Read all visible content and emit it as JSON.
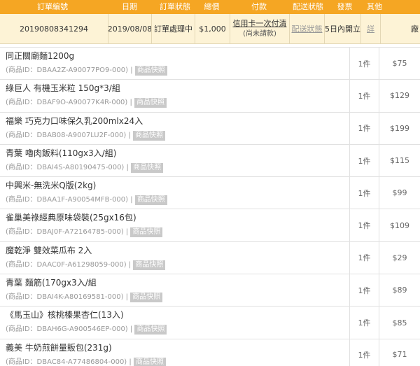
{
  "header": {
    "order_no": "訂單編號",
    "date": "日期",
    "status": "訂單狀態",
    "total": "總價",
    "payment": "付款",
    "shipping": "配送狀態",
    "invoice": "發票",
    "other": "其他"
  },
  "order": {
    "number": "20190808341294",
    "date": "2019/08/08",
    "status": "訂單處理中",
    "total": "$1,000",
    "payment_method": "信用卡一次付清",
    "payment_status": "(尚未請款)",
    "shipping_status": "配送狀態",
    "invoice": "5日內開立",
    "detail_link": "詳",
    "extra": "廠"
  },
  "items": [
    {
      "name": "同正關廟麵1200g",
      "code": "(商品ID：DBAA2Z-A90077PO9-000) |",
      "snapshot": "商品快照",
      "qty": "1件",
      "price": "$75"
    },
    {
      "name": "綠巨人 有機玉米粒 150g*3/組",
      "code": "(商品ID：DBAF9O-A90077K4R-000) |",
      "snapshot": "商品快照",
      "qty": "1件",
      "price": "$129"
    },
    {
      "name": "福樂 巧克力口味保久乳200mlx24入",
      "code": "(商品ID：DBAB08-A9007LU2F-000) |",
      "snapshot": "商品快照",
      "qty": "1件",
      "price": "$199"
    },
    {
      "name": "青葉 嚕肉飯料(110gx3入/組)",
      "code": "(商品ID：DBAI4S-A80190475-000) |",
      "snapshot": "商品快照",
      "qty": "1件",
      "price": "$115"
    },
    {
      "name": "中興米-無洗米Q版(2kg)",
      "code": "(商品ID：DBAA1F-A90054MFB-000) |",
      "snapshot": "商品快照",
      "qty": "1件",
      "price": "$99"
    },
    {
      "name": "雀巢美祿經典原味袋裝(25gx16包)",
      "code": "(商品ID：DBAJ0F-A72164785-000) |",
      "snapshot": "商品快照",
      "qty": "1件",
      "price": "$109"
    },
    {
      "name": "魔乾淨 雙效菜瓜布 2入",
      "code": "(商品ID：DAAC0F-A61298059-000) |",
      "snapshot": "商品快照",
      "qty": "1件",
      "price": "$29"
    },
    {
      "name": "青葉 麵筋(170gx3入/組",
      "code": "(商品ID：DBAI4K-A80169581-000) |",
      "snapshot": "商品快照",
      "qty": "1件",
      "price": "$89"
    },
    {
      "name": "《馬玉山》核桃榛果杏仁(13入)",
      "code": "(商品ID：DBAH6G-A900546EP-000) |",
      "snapshot": "商品快照",
      "qty": "1件",
      "price": "$85"
    },
    {
      "name": "義美 牛奶煎餅量販包(231g)",
      "code": "(商品ID：DBAC84-A77486804-000) |",
      "snapshot": "商品快照",
      "qty": "1件",
      "price": "$71"
    }
  ]
}
